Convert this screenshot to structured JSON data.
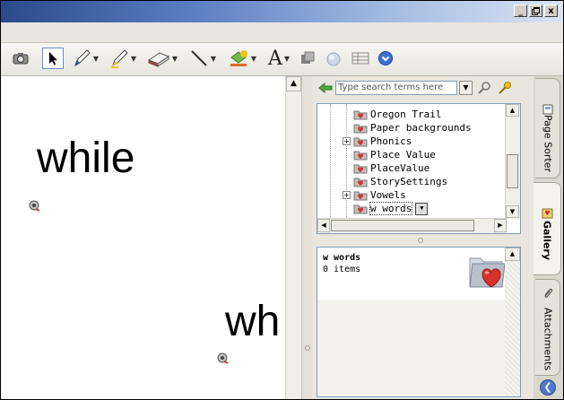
{
  "window": {
    "controls": {
      "minimize": "_",
      "maximize": " ",
      "close": "x"
    }
  },
  "toolbar": {
    "tools": [
      "camera-icon",
      "select-arrow-icon",
      "pen-icon",
      "highlighter-icon",
      "eraser-icon",
      "line-icon",
      "fill-icon",
      "text-icon",
      "layer-icon",
      "screen-shade-icon",
      "table-icon",
      "properties-icon"
    ],
    "text_tool_label": "A"
  },
  "canvas": {
    "words": [
      {
        "text": "while"
      },
      {
        "text": "wh"
      }
    ]
  },
  "gallery_panel": {
    "search": {
      "placeholder": "Type search terms here"
    },
    "tree": {
      "items": [
        {
          "label": "Oregon Trail",
          "expandable": false
        },
        {
          "label": "Paper backgrounds",
          "expandable": false
        },
        {
          "label": "Phonics",
          "expandable": true
        },
        {
          "label": "Place Value",
          "expandable": false
        },
        {
          "label": "PlaceValue",
          "expandable": false
        },
        {
          "label": "StorySettings",
          "expandable": false
        },
        {
          "label": "Vowels",
          "expandable": true
        },
        {
          "label": "w words",
          "expandable": false,
          "selected": true
        }
      ]
    },
    "collection": {
      "title": "w words",
      "count": "0 items"
    }
  },
  "side_tabs": [
    {
      "label": "Page Sorter",
      "icon": "page-sorter-icon",
      "active": false
    },
    {
      "label": "Gallery",
      "icon": "gallery-icon",
      "active": true
    },
    {
      "label": "Attachments",
      "icon": "paperclip-icon",
      "active": false
    }
  ],
  "colors": {
    "titlebar": "#2a4a8c",
    "selection_border": "#6c8cc4",
    "gallery_heart": "#d9322b"
  }
}
